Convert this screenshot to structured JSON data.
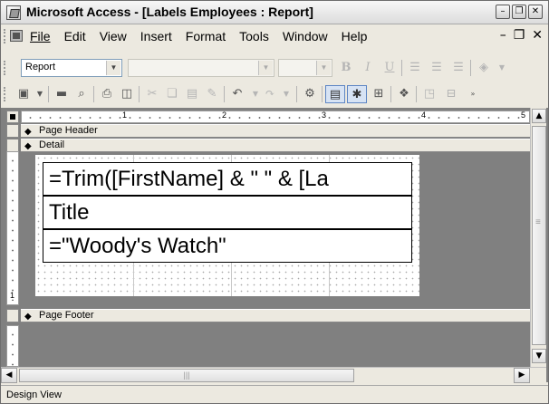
{
  "window": {
    "title": "Microsoft Access - [Labels Employees : Report]"
  },
  "menu": {
    "items": [
      {
        "label": "File"
      },
      {
        "label": "Edit"
      },
      {
        "label": "View"
      },
      {
        "label": "Insert"
      },
      {
        "label": "Format"
      },
      {
        "label": "Tools"
      },
      {
        "label": "Window"
      },
      {
        "label": "Help"
      }
    ]
  },
  "format_toolbar": {
    "object_combo": "Report",
    "font_combo": "",
    "size_combo": ""
  },
  "ruler": {
    "h_numbers": [
      "1",
      "2",
      "3",
      "4",
      "5"
    ],
    "v_number": "1"
  },
  "sections": {
    "page_header": "Page Header",
    "detail": "Detail",
    "page_footer": "Page Footer"
  },
  "detail_controls": [
    {
      "text": "=Trim([FirstName] & \" \" & [La"
    },
    {
      "text": "Title"
    },
    {
      "text": "=\"Woody's Watch\""
    }
  ],
  "status": {
    "text": "Design View"
  }
}
